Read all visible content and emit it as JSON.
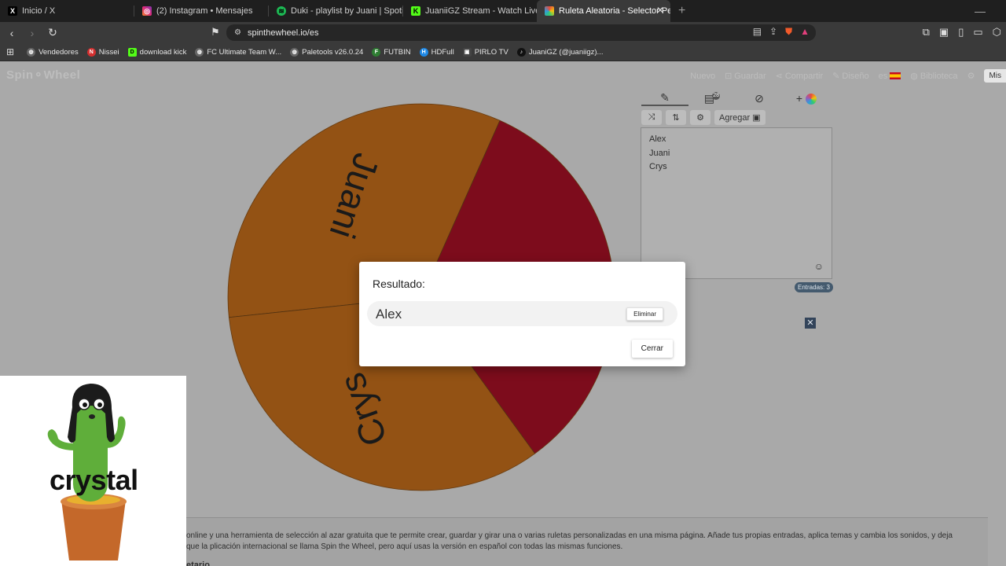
{
  "browser": {
    "tabs": [
      {
        "label": "Inicio / X",
        "icon": "x-logo-icon",
        "color": "#000000",
        "glyph": "X"
      },
      {
        "label": "(2) Instagram • Mensajes",
        "icon": "instagram-icon",
        "color": "#d6249f",
        "glyph": "◎"
      },
      {
        "label": "Duki - playlist by Juani | Spotify",
        "icon": "spotify-icon",
        "color": "#1db954",
        "glyph": "≋"
      },
      {
        "label": "JuaniiGZ Stream - Watch Live on",
        "icon": "kick-icon",
        "color": "#53fc18",
        "glyph": "K"
      },
      {
        "label": "Ruleta Aleatoria - Selector Perso",
        "icon": "spinthewheel-icon",
        "color": "#e74c3c",
        "glyph": "◉"
      }
    ],
    "new_tab": "+",
    "url": "spinthewheel.io/es",
    "bookmarks": [
      {
        "label": "Vendedores",
        "color": "#666666",
        "glyph": "◍"
      },
      {
        "label": "Nissei",
        "color": "#d32f2f",
        "glyph": "N"
      },
      {
        "label": "download kick",
        "color": "#53fc18",
        "glyph": "D"
      },
      {
        "label": "FC Ultimate Team W...",
        "color": "#666666",
        "glyph": "◍"
      },
      {
        "label": "Paletools v26.0.24",
        "color": "#666666",
        "glyph": "◍"
      },
      {
        "label": "FUTBIN",
        "color": "#2e7d32",
        "glyph": "F"
      },
      {
        "label": "HDFull",
        "color": "#1e88e5",
        "glyph": "H"
      },
      {
        "label": "PIRLO TV",
        "color": "#444444",
        "glyph": "▣"
      },
      {
        "label": "JuaniGZ (@juaniigz)...",
        "color": "#111111",
        "glyph": "♪"
      }
    ]
  },
  "site": {
    "logo": "Spin⚬Wheel",
    "nav": {
      "new": "Nuevo",
      "save": "Guardar",
      "share": "Compartir",
      "design": "Diseño",
      "lang": "es",
      "library": "Biblioteca",
      "signin": "Mis"
    }
  },
  "wheel": {
    "segments": [
      {
        "label": "Juani",
        "color": "#d97a1e"
      },
      {
        "label": "Alex",
        "color": "#b8122a"
      },
      {
        "label": "Crys",
        "color": "#d97a1e"
      }
    ]
  },
  "panel": {
    "tab_badge": "28",
    "add_label": "Agregar",
    "entries": [
      "Alex",
      "Juani",
      "Crys"
    ],
    "count_label": "Entradas: 3"
  },
  "description": {
    "text": "online y una herramienta de selección al azar gratuita que te permite crear, guardar y girar una o varias ruletas personalizadas en una misma página. Añade tus propias entradas, aplica temas y cambia los sonidos, y deja que la plicación internacional se llama Spin the Wheel, pero aquí usas la versión en español con todas las mismas funciones.",
    "heading": "etario"
  },
  "sticker": {
    "text": "crystal"
  },
  "modal": {
    "title": "Resultado:",
    "result": "Alex",
    "remove_label": "Eliminar",
    "close_label": "Cerrar"
  }
}
